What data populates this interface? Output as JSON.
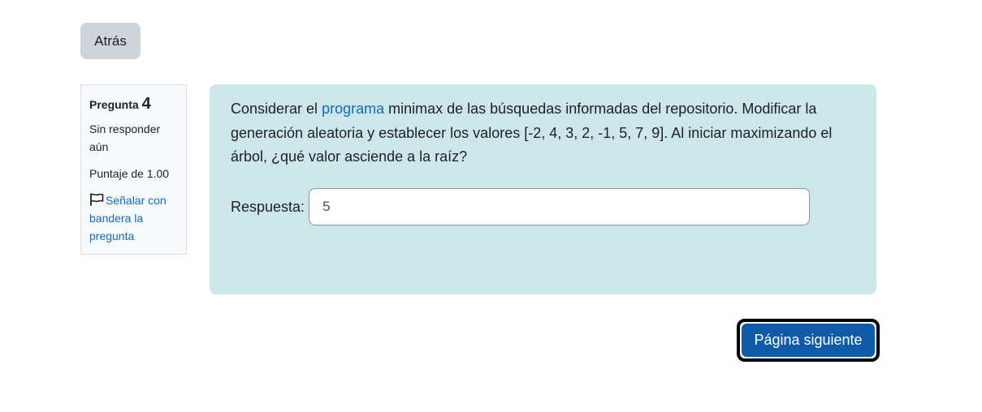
{
  "nav": {
    "back_label": "Atrás",
    "next_label": "Página siguiente"
  },
  "question_info": {
    "heading_label": "Pregunta",
    "number": "4",
    "status": "Sin responder aún",
    "score": "Puntaje de 1.00",
    "flag_label": "Señalar con bandera la pregunta",
    "flag_icon": "flag-outline-icon"
  },
  "question": {
    "text_before_link": "Considerar el ",
    "link_text": "programa",
    "text_after_link": " minimax de las búsquedas informadas del repositorio. Modificar la generación aleatoria y establecer los valores [-2, 4, 3, 2, -1, 5, 7, 9]. Al iniciar maximizando el árbol, ¿qué valor asciende a la raíz?",
    "answer_label": "Respuesta:",
    "answer_value": "5"
  },
  "colors": {
    "question_background": "#cce6ea",
    "link": "#0f6cbf",
    "primary_button": "#0f5ba8",
    "secondary_button": "#ced4da"
  }
}
